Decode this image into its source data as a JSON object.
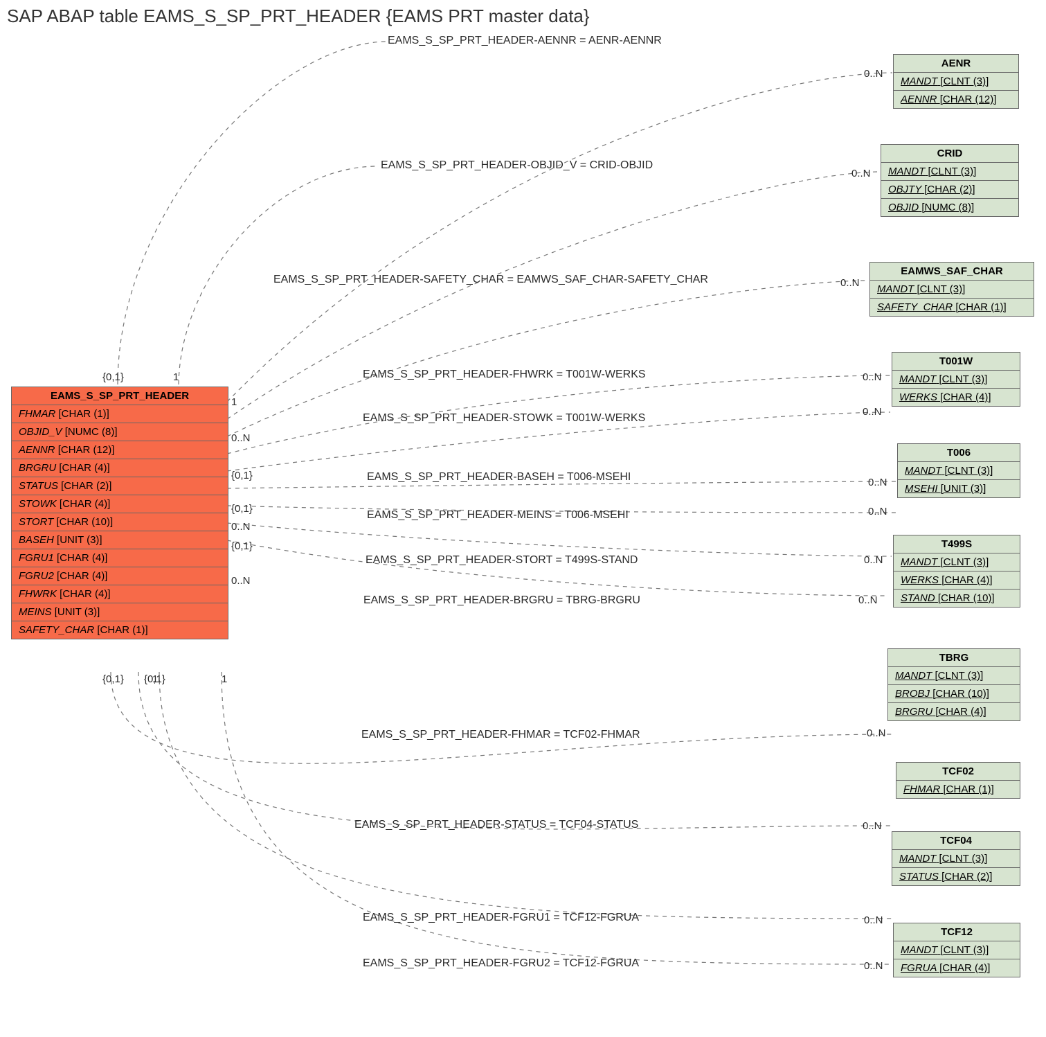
{
  "title": "SAP ABAP table EAMS_S_SP_PRT_HEADER {EAMS PRT master data}",
  "main_table": {
    "name": "EAMS_S_SP_PRT_HEADER",
    "fields": [
      {
        "name": "FHMAR",
        "type": "[CHAR (1)]"
      },
      {
        "name": "OBJID_V",
        "type": "[NUMC (8)]"
      },
      {
        "name": "AENNR",
        "type": "[CHAR (12)]"
      },
      {
        "name": "BRGRU",
        "type": "[CHAR (4)]"
      },
      {
        "name": "STATUS",
        "type": "[CHAR (2)]"
      },
      {
        "name": "STOWK",
        "type": "[CHAR (4)]"
      },
      {
        "name": "STORT",
        "type": "[CHAR (10)]"
      },
      {
        "name": "BASEH",
        "type": "[UNIT (3)]"
      },
      {
        "name": "FGRU1",
        "type": "[CHAR (4)]"
      },
      {
        "name": "FGRU2",
        "type": "[CHAR (4)]"
      },
      {
        "name": "FHWRK",
        "type": "[CHAR (4)]"
      },
      {
        "name": "MEINS",
        "type": "[UNIT (3)]"
      },
      {
        "name": "SAFETY_CHAR",
        "type": "[CHAR (1)]"
      }
    ]
  },
  "ref_tables": [
    {
      "name": "AENR",
      "fields": [
        {
          "name": "MANDT",
          "type": "[CLNT (3)]",
          "u": true
        },
        {
          "name": "AENNR",
          "type": "[CHAR (12)]",
          "u": true
        }
      ]
    },
    {
      "name": "CRID",
      "fields": [
        {
          "name": "MANDT",
          "type": "[CLNT (3)]",
          "u": true
        },
        {
          "name": "OBJTY",
          "type": "[CHAR (2)]",
          "u": true
        },
        {
          "name": "OBJID",
          "type": "[NUMC (8)]",
          "u": true
        }
      ]
    },
    {
      "name": "EAMWS_SAF_CHAR",
      "fields": [
        {
          "name": "MANDT",
          "type": "[CLNT (3)]",
          "u": true
        },
        {
          "name": "SAFETY_CHAR",
          "type": "[CHAR (1)]",
          "u": true
        }
      ]
    },
    {
      "name": "T001W",
      "fields": [
        {
          "name": "MANDT",
          "type": "[CLNT (3)]",
          "u": true
        },
        {
          "name": "WERKS",
          "type": "[CHAR (4)]",
          "u": true
        }
      ]
    },
    {
      "name": "T006",
      "fields": [
        {
          "name": "MANDT",
          "type": "[CLNT (3)]",
          "u": true
        },
        {
          "name": "MSEHI",
          "type": "[UNIT (3)]",
          "u": true
        }
      ]
    },
    {
      "name": "T499S",
      "fields": [
        {
          "name": "MANDT",
          "type": "[CLNT (3)]",
          "u": true
        },
        {
          "name": "WERKS",
          "type": "[CHAR (4)]",
          "u": true
        },
        {
          "name": "STAND",
          "type": "[CHAR (10)]",
          "u": true
        }
      ]
    },
    {
      "name": "TBRG",
      "fields": [
        {
          "name": "MANDT",
          "type": "[CLNT (3)]",
          "u": true
        },
        {
          "name": "BROBJ",
          "type": "[CHAR (10)]",
          "u": true
        },
        {
          "name": "BRGRU",
          "type": "[CHAR (4)]",
          "u": true
        }
      ]
    },
    {
      "name": "TCF02",
      "fields": [
        {
          "name": "FHMAR",
          "type": "[CHAR (1)]",
          "u": true
        }
      ]
    },
    {
      "name": "TCF04",
      "fields": [
        {
          "name": "MANDT",
          "type": "[CLNT (3)]",
          "u": true
        },
        {
          "name": "STATUS",
          "type": "[CHAR (2)]",
          "u": true
        }
      ]
    },
    {
      "name": "TCF12",
      "fields": [
        {
          "name": "MANDT",
          "type": "[CLNT (3)]",
          "u": true
        },
        {
          "name": "FGRUA",
          "type": "[CHAR (4)]",
          "u": true
        }
      ]
    }
  ],
  "relations": [
    {
      "label": "EAMS_S_SP_PRT_HEADER-AENNR = AENR-AENNR"
    },
    {
      "label": "EAMS_S_SP_PRT_HEADER-OBJID_V = CRID-OBJID"
    },
    {
      "label": "EAMS_S_SP_PRT_HEADER-SAFETY_CHAR = EAMWS_SAF_CHAR-SAFETY_CHAR"
    },
    {
      "label": "EAMS_S_SP_PRT_HEADER-FHWRK = T001W-WERKS"
    },
    {
      "label": "EAMS_S_SP_PRT_HEADER-STOWK = T001W-WERKS"
    },
    {
      "label": "EAMS_S_SP_PRT_HEADER-BASEH = T006-MSEHI"
    },
    {
      "label": "EAMS_S_SP_PRT_HEADER-MEINS = T006-MSEHI"
    },
    {
      "label": "EAMS_S_SP_PRT_HEADER-STORT = T499S-STAND"
    },
    {
      "label": "EAMS_S_SP_PRT_HEADER-BRGRU = TBRG-BRGRU"
    },
    {
      "label": "EAMS_S_SP_PRT_HEADER-FHMAR = TCF02-FHMAR"
    },
    {
      "label": "EAMS_S_SP_PRT_HEADER-STATUS = TCF04-STATUS"
    },
    {
      "label": "EAMS_S_SP_PRT_HEADER-FGRU1 = TCF12-FGRUA"
    },
    {
      "label": "EAMS_S_SP_PRT_HEADER-FGRU2 = TCF12-FGRUA"
    }
  ],
  "cards": {
    "zeroN": "0..N",
    "one": "1",
    "zeroOne": "{0,1}",
    "zeroOneBrace": "{0,1}",
    "leftBottom1": "{0,1}",
    "leftBottom2": "{0,1}",
    "leftBottom3": "1",
    "leftBottom4": "1"
  }
}
